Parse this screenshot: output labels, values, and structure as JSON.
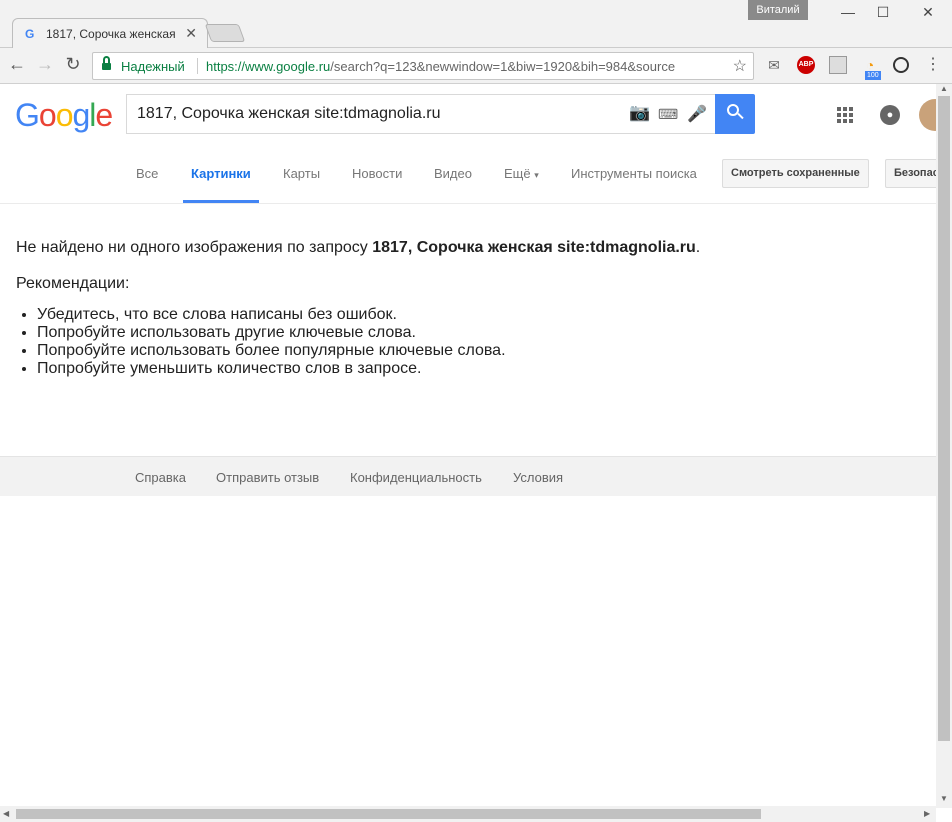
{
  "browser": {
    "tab_title": "1817, Сорочка женская",
    "user_badge": "Виталий",
    "secure_label": "Надежный",
    "url_host": "https://www.google.ru",
    "url_rest": "/search?q=123&newwindow=1&biw=1920&bih=984&source",
    "rss_badge": "100",
    "abp_label": "ABP"
  },
  "search": {
    "query": "1817, Сорочка женская site:tdmagnolia.ru"
  },
  "tabs": [
    {
      "label": "Все"
    },
    {
      "label": "Картинки"
    },
    {
      "label": "Карты"
    },
    {
      "label": "Новости"
    },
    {
      "label": "Видео"
    },
    {
      "label": "Ещё"
    },
    {
      "label": "Инструменты поиска"
    }
  ],
  "buttons": {
    "saved": "Смотреть сохраненные",
    "safe": "Безопас"
  },
  "results": {
    "not_found_prefix": "Не найдено ни одного изображения по запросу ",
    "not_found_query": "1817, Сорочка женская site:tdmagnolia.ru",
    "not_found_suffix": ".",
    "recommendations_title": "Рекомендации:",
    "tips": [
      "Убедитесь, что все слова написаны без ошибок.",
      "Попробуйте использовать другие ключевые слова.",
      "Попробуйте использовать более популярные ключевые слова.",
      "Попробуйте уменьшить количество слов в запросе."
    ]
  },
  "footer": {
    "links": [
      "Справка",
      "Отправить отзыв",
      "Конфиденциальность",
      "Условия"
    ]
  },
  "colors": {
    "accent": "#4285f4",
    "secure_green": "#0b8043"
  }
}
